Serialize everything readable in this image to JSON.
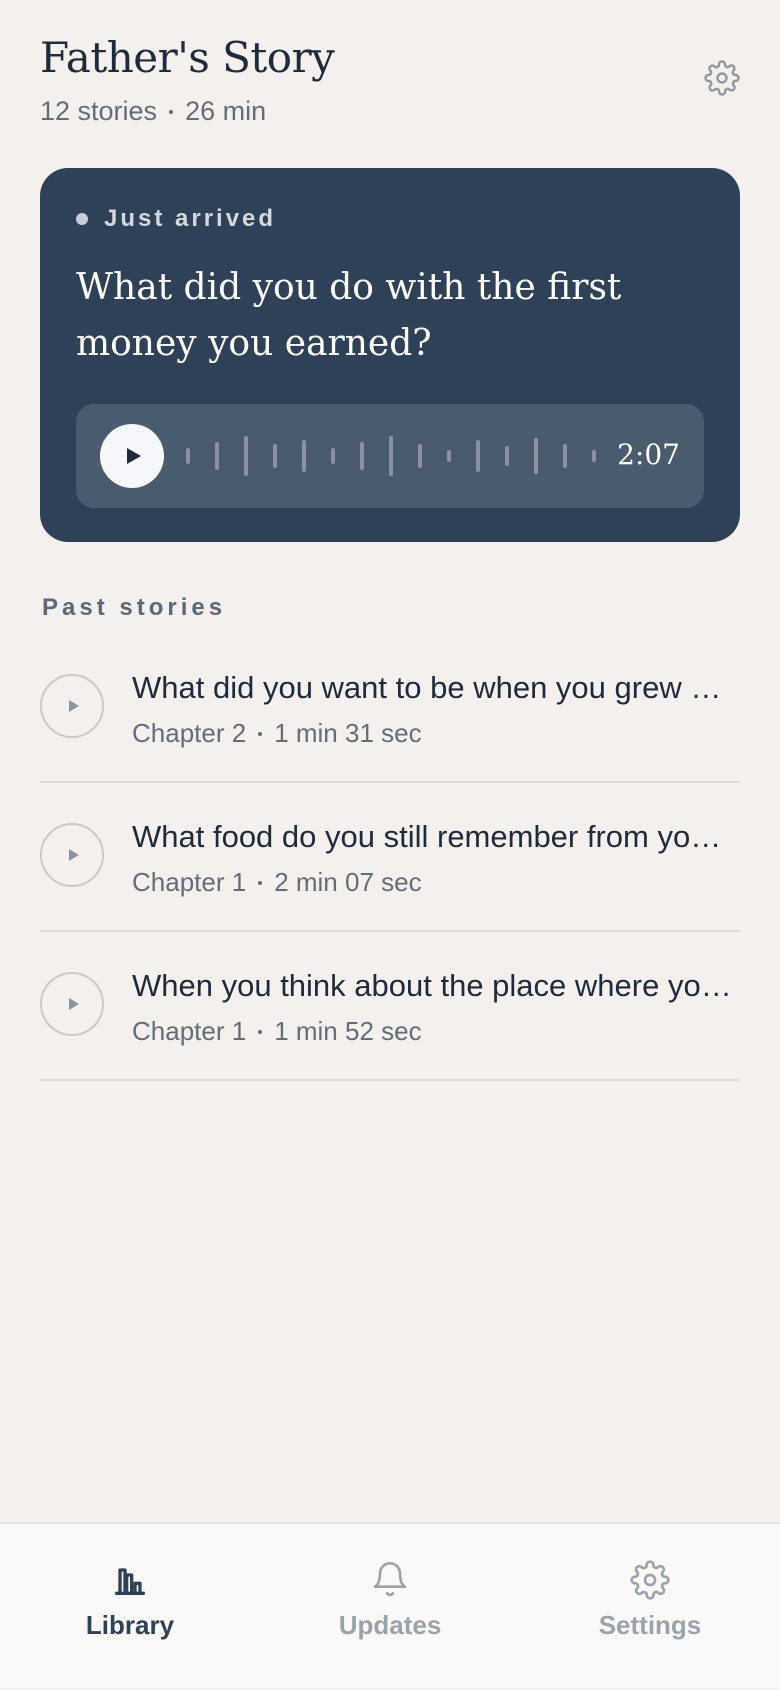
{
  "header": {
    "title": "Father's Story",
    "story_count": "12 stories",
    "total_duration": "26 min",
    "settings_icon": "gear-icon"
  },
  "hero": {
    "tag": "Just arrived",
    "question": "What did you do with the first money you earned?",
    "duration": "2:07",
    "play_icon": "play-icon"
  },
  "past": {
    "label": "Past stories",
    "items": [
      {
        "title": "What did you want to be when you grew up?",
        "chapter": "Chapter 2",
        "length": "1 min 31 sec"
      },
      {
        "title": "What food do you still remember from your childhood?",
        "chapter": "Chapter 1",
        "length": "2 min 07 sec"
      },
      {
        "title": "When you think about the place where you grew up...",
        "chapter": "Chapter 1",
        "length": "1 min 52 sec"
      }
    ]
  },
  "tabs": [
    {
      "label": "Library",
      "icon": "library-icon",
      "active": true
    },
    {
      "label": "Updates",
      "icon": "bell-icon",
      "active": false
    },
    {
      "label": "Settings",
      "icon": "gear-icon",
      "active": false
    }
  ],
  "colors": {
    "background": "#f4f0ed",
    "hero": "#2f4157",
    "active_tab": "#2f4157",
    "inactive_tab": "#9aa2ab"
  }
}
